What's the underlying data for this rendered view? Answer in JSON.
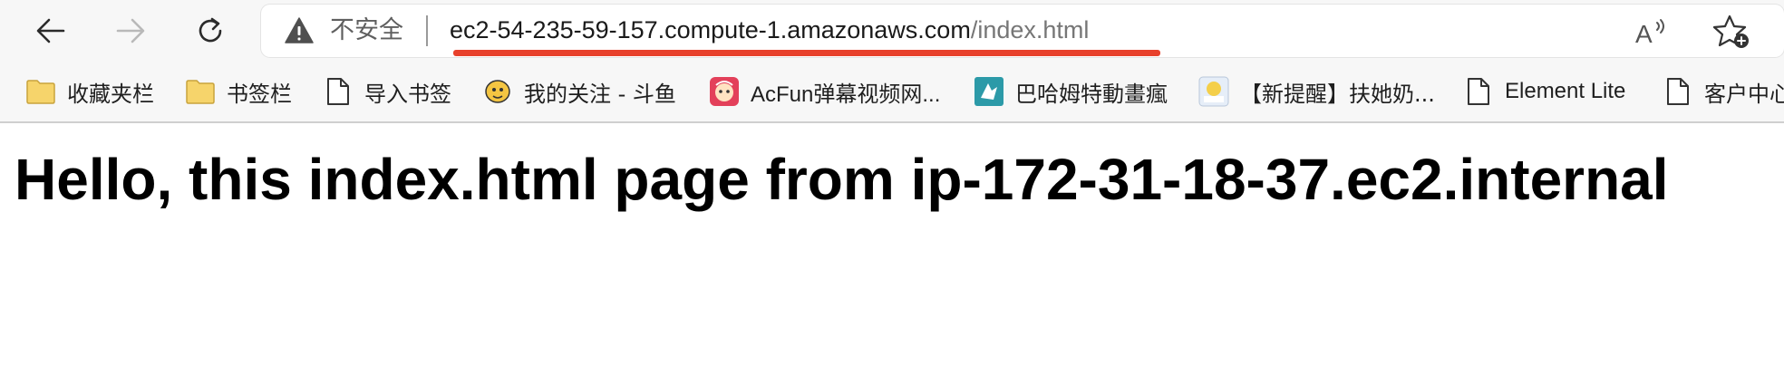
{
  "browser": {
    "nav": {
      "back_icon": "arrow-left-icon",
      "forward_icon": "arrow-right-icon",
      "reload_icon": "reload-icon"
    },
    "address_bar": {
      "security_icon": "warning-triangle-icon",
      "security_label": "不安全",
      "url_host": "ec2-54-235-59-157.compute-1.amazonaws.com",
      "url_path": "/index.html",
      "highlight_color": "#e8412c",
      "read_aloud_icon": "read-aloud-icon",
      "favorite_icon": "add-favorite-star-icon"
    },
    "bookmarks": [
      {
        "icon": "folder-icon",
        "label": "收藏夹栏"
      },
      {
        "icon": "folder-icon",
        "label": "书签栏"
      },
      {
        "icon": "page-icon",
        "label": "导入书签"
      },
      {
        "icon": "douyu-icon",
        "label": "我的关注 - 斗鱼"
      },
      {
        "icon": "acfun-icon",
        "label": "AcFun弹幕视频网..."
      },
      {
        "icon": "bahamut-icon",
        "label": "巴哈姆特動畫瘋"
      },
      {
        "icon": "image-thumbnail-icon",
        "label": "【新提醒】扶她奶..."
      },
      {
        "icon": "page-icon",
        "label": "Element Lite"
      },
      {
        "icon": "page-icon",
        "label": "客户中心"
      }
    ]
  },
  "page": {
    "heading": "Hello, this index.html page from ip-172-31-18-37.ec2.internal"
  }
}
